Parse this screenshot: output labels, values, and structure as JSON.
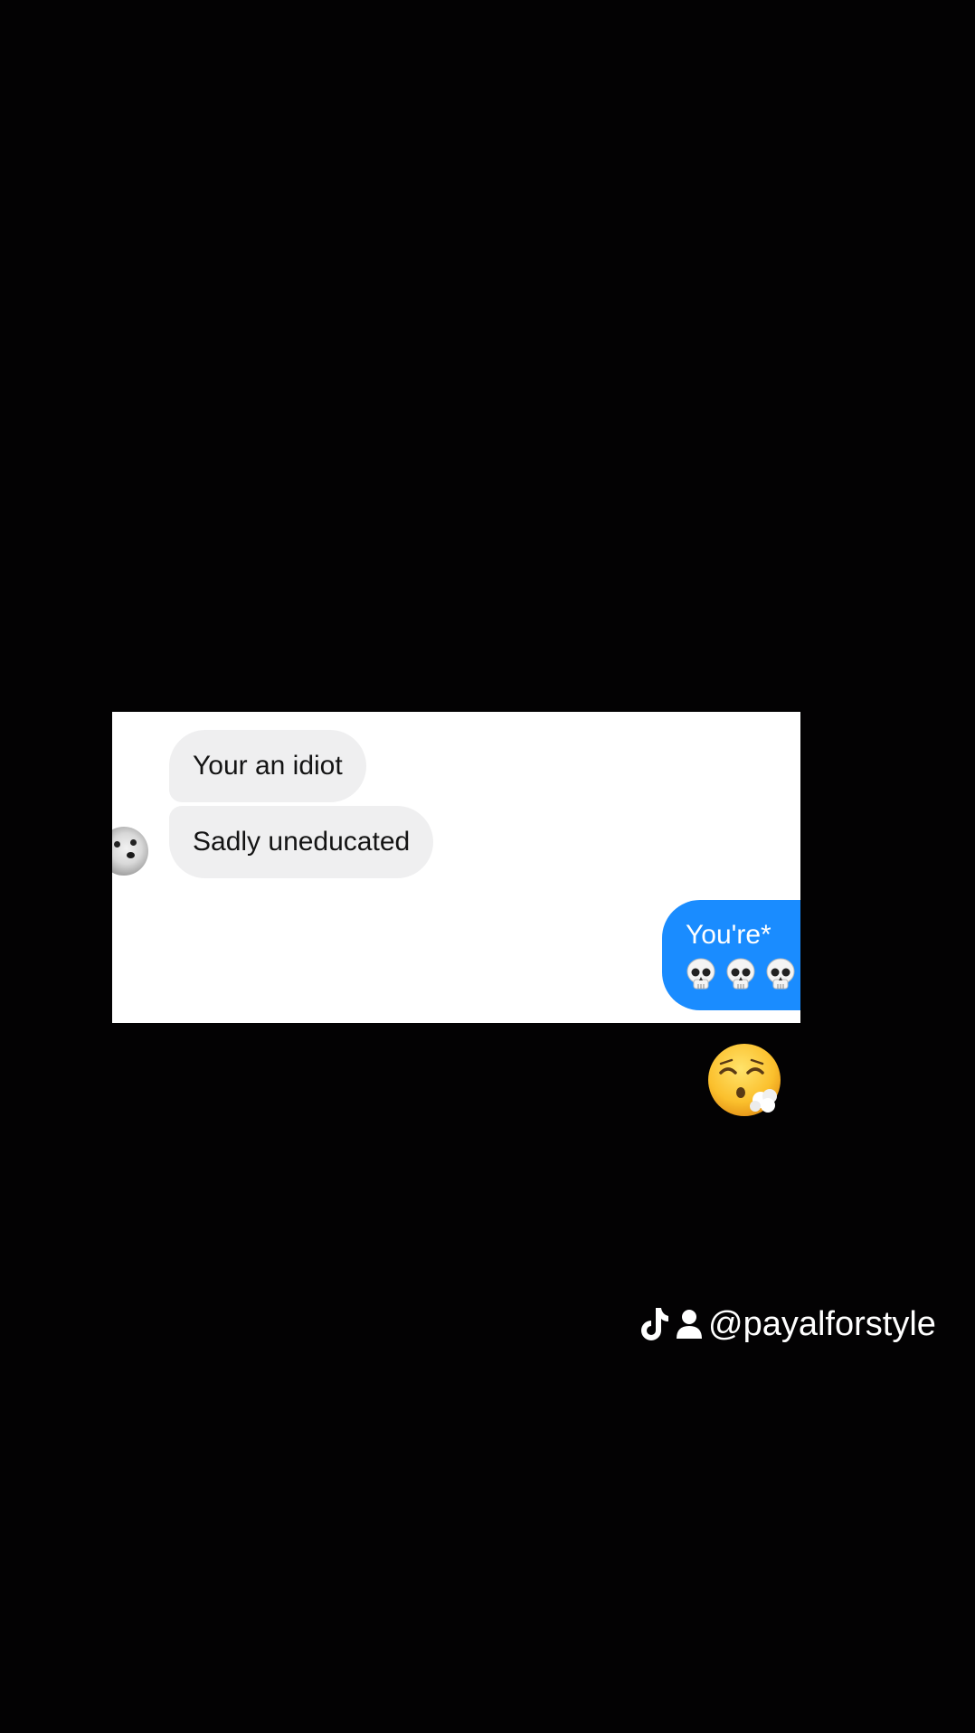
{
  "messages": [
    {
      "sender": "them",
      "text": "Your an idiot"
    },
    {
      "sender": "them",
      "text": "Sadly uneducated"
    },
    {
      "sender": "me",
      "text": "You're*",
      "emojis": [
        "skull",
        "skull",
        "skull"
      ]
    }
  ],
  "reaction_emoji": "face-with-steam-from-mouth",
  "watermark": {
    "icons": [
      "tiktok-icon",
      "person-icon"
    ],
    "handle": "@payalforstyle"
  },
  "colors": {
    "background": "#030203",
    "received_bubble": "#efeff0",
    "sent_bubble": "#1a8cff"
  }
}
